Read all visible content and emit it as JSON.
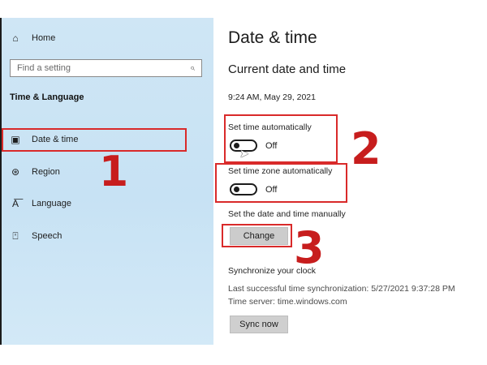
{
  "sidebar": {
    "home_label": "Home",
    "search_placeholder": "Find a setting",
    "section_title": "Time & Language",
    "items": [
      {
        "label": "Date & time",
        "icon": "calendar-clock-icon"
      },
      {
        "label": "Region",
        "icon": "globe-icon"
      },
      {
        "label": "Language",
        "icon": "language-icon"
      },
      {
        "label": "Speech",
        "icon": "microphone-icon"
      }
    ]
  },
  "main": {
    "title": "Date & time",
    "subtitle": "Current date and time",
    "current_datetime": "9:24 AM, May 29, 2021",
    "set_time_auto": {
      "label": "Set time automatically",
      "state": "Off"
    },
    "set_timezone_auto": {
      "label": "Set time zone automatically",
      "state": "Off"
    },
    "manual_label": "Set the date and time manually",
    "change_button": "Change",
    "sync_title": "Synchronize your clock",
    "last_sync": "Last successful time synchronization: 5/27/2021 9:37:28 PM",
    "time_server": "Time server: time.windows.com",
    "sync_button": "Sync now"
  },
  "annotations": {
    "callout_1": "1",
    "callout_2": "2",
    "callout_3": "3",
    "color": "#d92a2a"
  }
}
